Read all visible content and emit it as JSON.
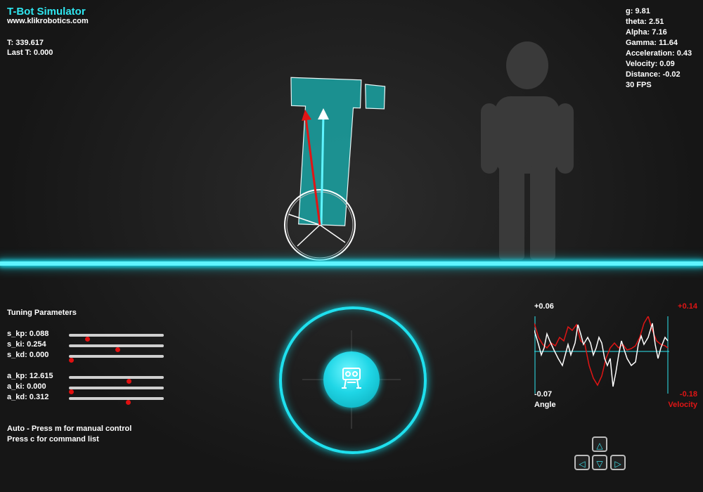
{
  "header": {
    "title": "T-Bot Simulator",
    "site": "www.klikrobotics.com",
    "t": "T: 339.617",
    "last_t": "Last T: 0.000"
  },
  "stats": {
    "g": "g: 9.81",
    "theta": "theta: 2.51",
    "alpha": "Alpha: 7.16",
    "gamma": "Gamma: 11.64",
    "acceleration": "Acceleration: 0.43",
    "velocity": "Velocity: 0.09",
    "distance": "Distance: -0.02",
    "fps": "30 FPS"
  },
  "tuning": {
    "title": "Tuning Parameters",
    "params": [
      {
        "label": "s_kp: 0.088",
        "level": 0.19
      },
      {
        "label": "s_ki: 0.254",
        "level": 0.51
      },
      {
        "label": "s_kd: 0.000",
        "level": 0.02
      },
      {
        "label": "a_kp: 12.615",
        "level": 0.63
      },
      {
        "label": "a_ki: 0.000",
        "level": 0.02
      },
      {
        "label": "a_kd: 0.312",
        "level": 0.62
      }
    ]
  },
  "status": {
    "mode": "Auto - Press m for manual control",
    "command": "Press c for command list"
  },
  "chart": {
    "angle_max": "+0.06",
    "angle_min": "-0.07",
    "angle_label": "Angle",
    "velocity_max": "+0.14",
    "velocity_min": "-0.18",
    "velocity_label": "Velocity"
  },
  "colors": {
    "accent": "#1fe0ee",
    "velocity": "#e01515",
    "angle": "#ffffff"
  },
  "icons": {
    "joystick": "robot-icon",
    "up": "arrow-up-icon",
    "left": "arrow-left-icon",
    "down": "arrow-down-icon",
    "right": "arrow-right-icon"
  }
}
